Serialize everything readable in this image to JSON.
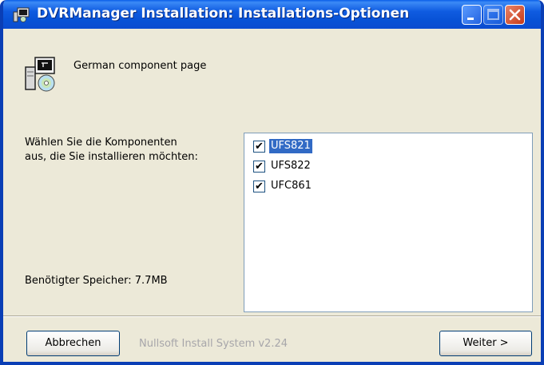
{
  "window": {
    "title": "DVRManager Installation: Installations-Optionen",
    "controls": {
      "minimize_icon": "minimize-icon",
      "maximize_icon": "maximize-icon",
      "close_icon": "close-icon"
    }
  },
  "header": {
    "text": "German component page",
    "icon": "installer-package-icon"
  },
  "body": {
    "description_line1": "Wählen Sie die Komponenten",
    "description_line2": "aus, die Sie installieren möchten:",
    "space_required": "Benötigter Speicher: 7.7MB"
  },
  "components": [
    {
      "label": "UFS821",
      "checked": true,
      "selected": true
    },
    {
      "label": "UFS822",
      "checked": true,
      "selected": false
    },
    {
      "label": "UFC861",
      "checked": true,
      "selected": false
    }
  ],
  "footer": {
    "cancel_label": "Abbrechen",
    "branding": "Nullsoft Install System v2.24",
    "next_label": "Weiter >"
  },
  "colors": {
    "titlebar": "#0A56DB",
    "selection": "#316AC5",
    "dialog_bg": "#ECE9D8",
    "close_button": "#D9532F"
  }
}
